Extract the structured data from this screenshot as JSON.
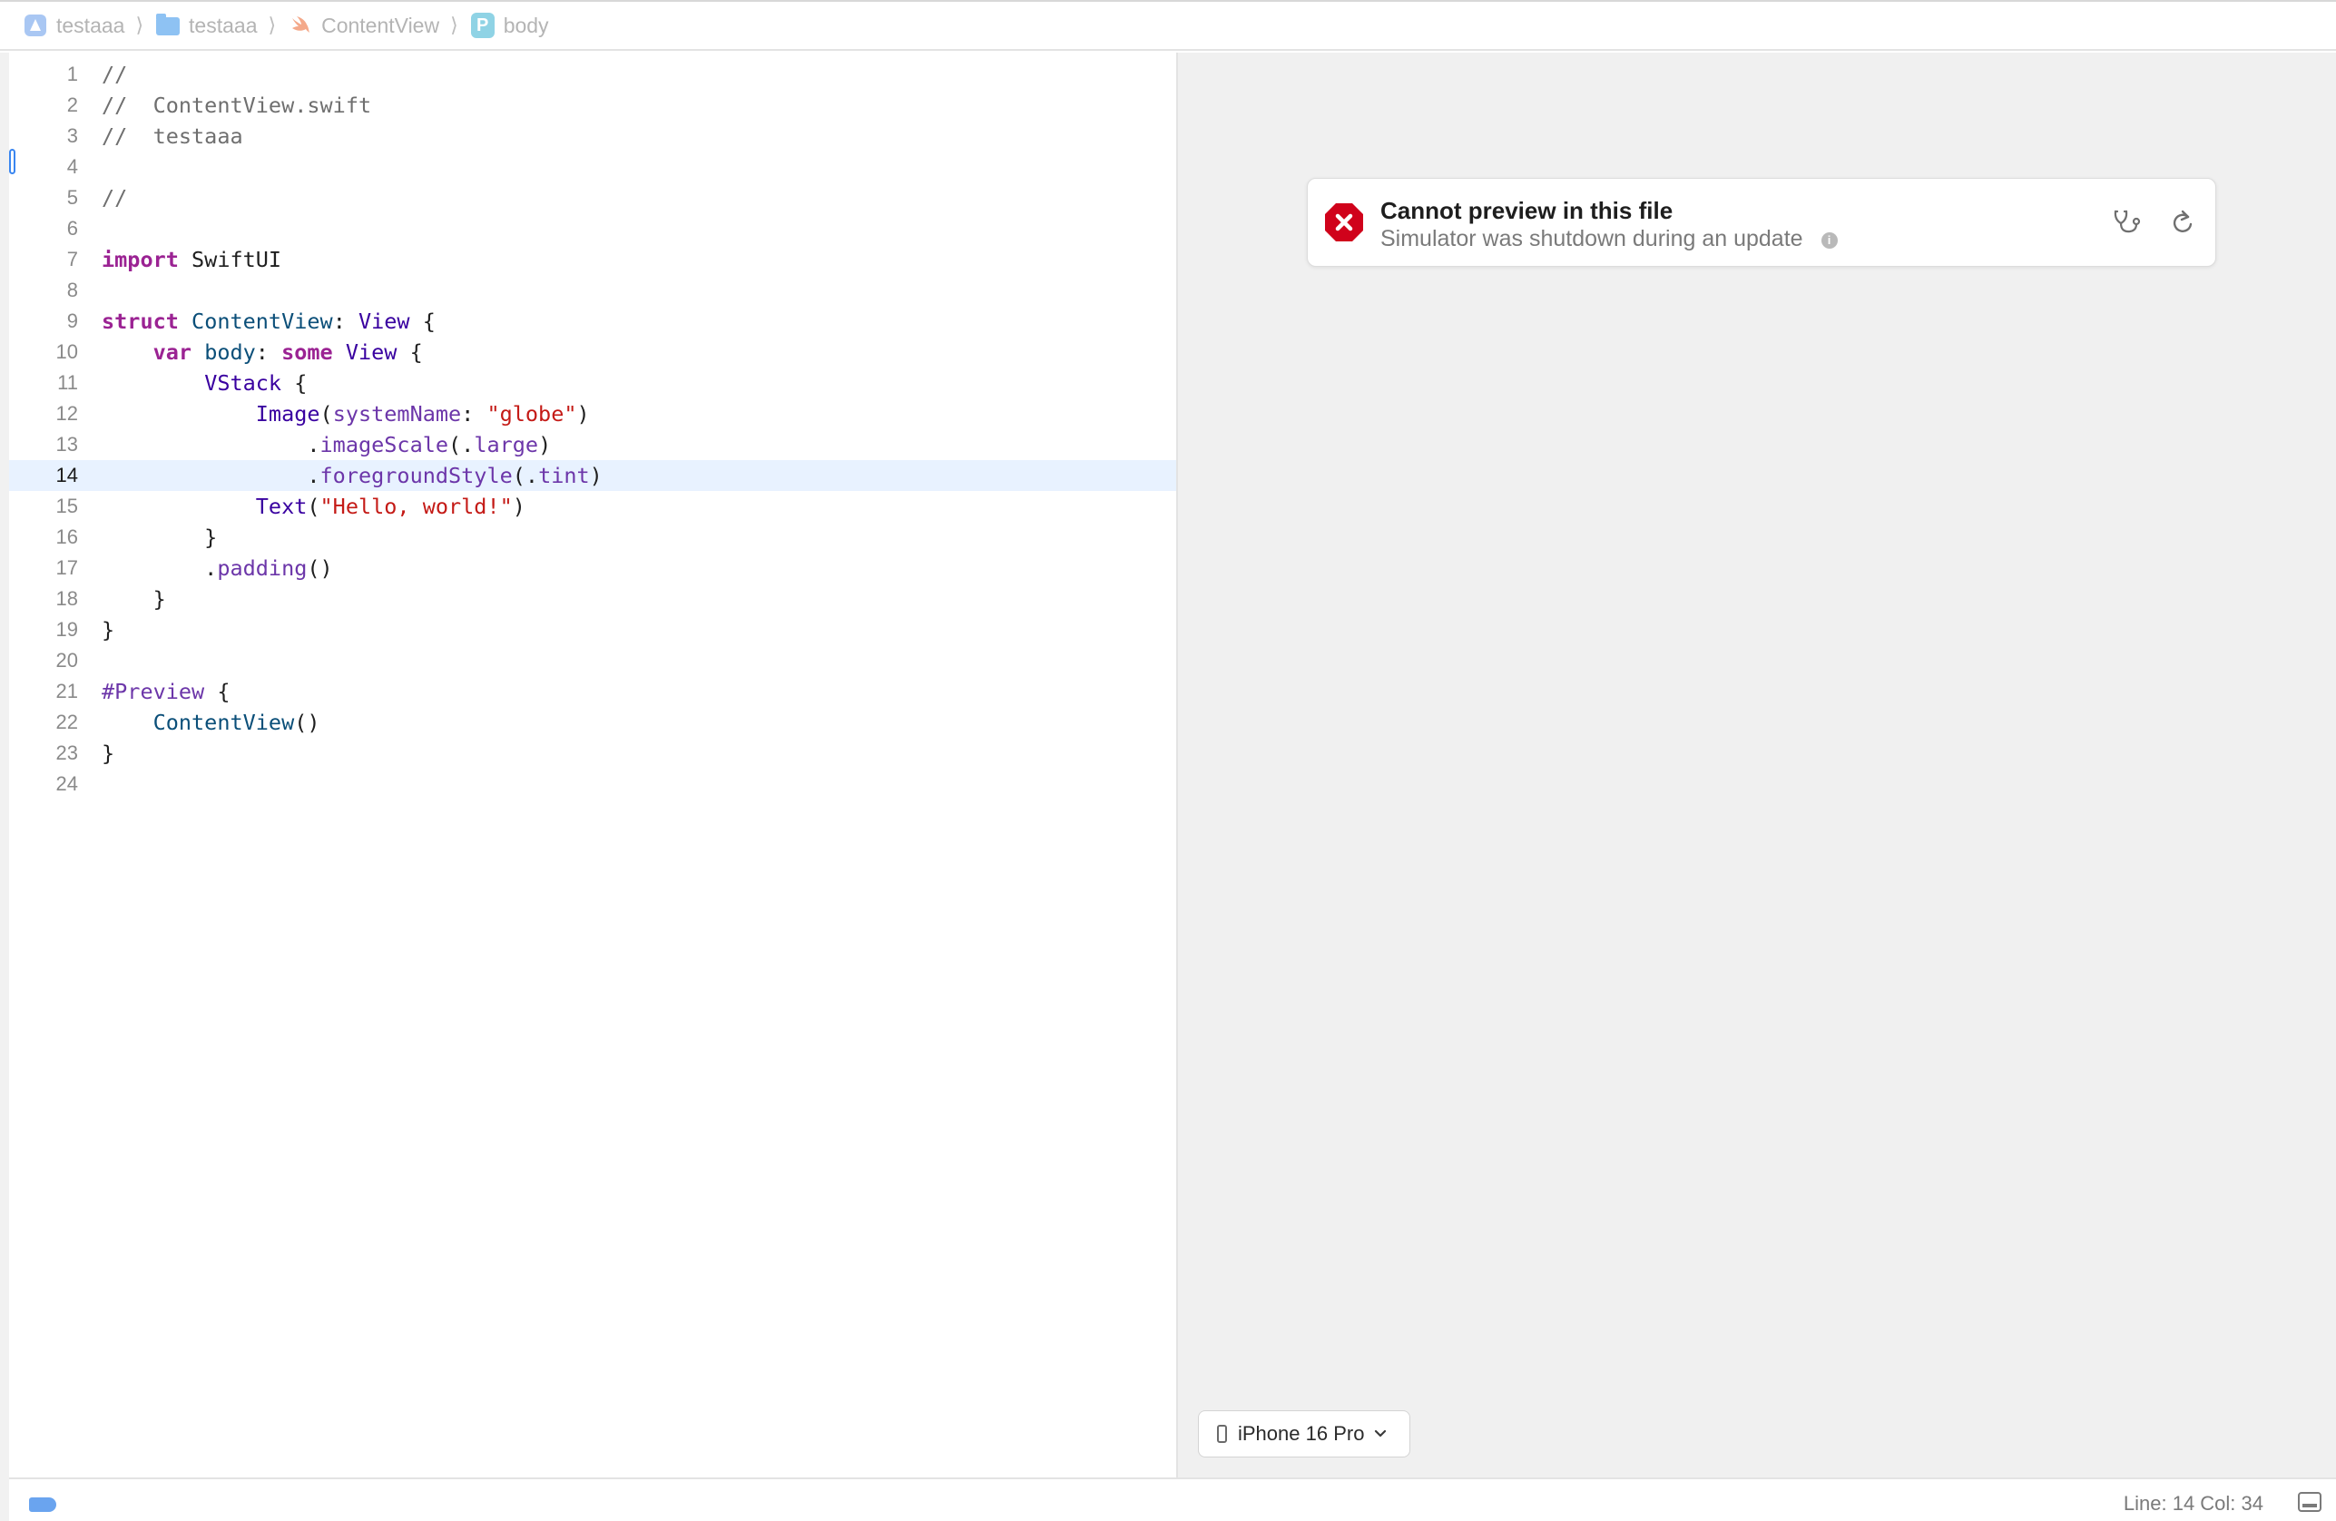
{
  "breadcrumb": {
    "items": [
      {
        "label": "testaaa",
        "icon": "app-project-icon"
      },
      {
        "label": "testaaa",
        "icon": "folder-icon"
      },
      {
        "label": "ContentView",
        "icon": "swift-file-icon"
      },
      {
        "label": "body",
        "icon": "property-icon",
        "badge": "P"
      }
    ]
  },
  "editor": {
    "current_line": 14,
    "lines": [
      {
        "n": "1",
        "tokens": [
          [
            "com",
            "//"
          ]
        ]
      },
      {
        "n": "2",
        "tokens": [
          [
            "com",
            "//  ContentView.swift"
          ]
        ]
      },
      {
        "n": "3",
        "tokens": [
          [
            "com",
            "//  testaaa"
          ]
        ]
      },
      {
        "n": "4",
        "tokens": []
      },
      {
        "n": "5",
        "tokens": [
          [
            "com",
            "//"
          ]
        ]
      },
      {
        "n": "6",
        "tokens": []
      },
      {
        "n": "7",
        "tokens": [
          [
            "kw",
            "import"
          ],
          [
            "plain",
            " SwiftUI"
          ]
        ]
      },
      {
        "n": "8",
        "tokens": []
      },
      {
        "n": "9",
        "tokens": [
          [
            "kw",
            "struct"
          ],
          [
            "plain",
            " "
          ],
          [
            "type",
            "ContentView"
          ],
          [
            "plain",
            ": "
          ],
          [
            "sys",
            "View"
          ],
          [
            "plain",
            " {"
          ]
        ]
      },
      {
        "n": "10",
        "tokens": [
          [
            "plain",
            "    "
          ],
          [
            "kw",
            "var"
          ],
          [
            "plain",
            " "
          ],
          [
            "type",
            "body"
          ],
          [
            "plain",
            ": "
          ],
          [
            "kw",
            "some"
          ],
          [
            "plain",
            " "
          ],
          [
            "sys",
            "View"
          ],
          [
            "plain",
            " {"
          ]
        ]
      },
      {
        "n": "11",
        "tokens": [
          [
            "plain",
            "        "
          ],
          [
            "sys",
            "VStack"
          ],
          [
            "plain",
            " {"
          ]
        ]
      },
      {
        "n": "12",
        "tokens": [
          [
            "plain",
            "            "
          ],
          [
            "sys",
            "Image"
          ],
          [
            "plain",
            "("
          ],
          [
            "prop",
            "systemName"
          ],
          [
            "plain",
            ": "
          ],
          [
            "str",
            "\"globe\""
          ],
          [
            "plain",
            ")"
          ]
        ]
      },
      {
        "n": "13",
        "tokens": [
          [
            "plain",
            "                ."
          ],
          [
            "prop",
            "imageScale"
          ],
          [
            "plain",
            "(."
          ],
          [
            "prop",
            "large"
          ],
          [
            "plain",
            ")"
          ]
        ]
      },
      {
        "n": "14",
        "tokens": [
          [
            "plain",
            "                ."
          ],
          [
            "prop",
            "foregroundStyle"
          ],
          [
            "plain",
            "(."
          ],
          [
            "prop",
            "tint"
          ],
          [
            "plain",
            ")"
          ]
        ]
      },
      {
        "n": "15",
        "tokens": [
          [
            "plain",
            "            "
          ],
          [
            "sys",
            "Text"
          ],
          [
            "plain",
            "("
          ],
          [
            "str",
            "\"Hello, world!\""
          ],
          [
            "plain",
            ")"
          ]
        ]
      },
      {
        "n": "16",
        "tokens": [
          [
            "plain",
            "        }"
          ]
        ]
      },
      {
        "n": "17",
        "tokens": [
          [
            "plain",
            "        ."
          ],
          [
            "prop",
            "padding"
          ],
          [
            "plain",
            "()"
          ]
        ]
      },
      {
        "n": "18",
        "tokens": [
          [
            "plain",
            "    }"
          ]
        ]
      },
      {
        "n": "19",
        "tokens": [
          [
            "plain",
            "}"
          ]
        ]
      },
      {
        "n": "20",
        "tokens": []
      },
      {
        "n": "21",
        "tokens": [
          [
            "prop",
            "#Preview"
          ],
          [
            "plain",
            " {"
          ]
        ]
      },
      {
        "n": "22",
        "tokens": [
          [
            "plain",
            "    "
          ],
          [
            "type",
            "ContentView"
          ],
          [
            "plain",
            "()"
          ]
        ]
      },
      {
        "n": "23",
        "tokens": [
          [
            "plain",
            "}"
          ]
        ]
      },
      {
        "n": "24",
        "tokens": []
      }
    ]
  },
  "preview": {
    "error_title": "Cannot preview in this file",
    "error_subtitle": "Simulator was shutdown during an update",
    "info_glyph": "i",
    "device_label": "iPhone 16 Pro"
  },
  "status": {
    "line_col": "Line: 14  Col: 34"
  },
  "colors": {
    "keyword": "#9b2393",
    "type": "#0b4f79",
    "system": "#3900a0",
    "property": "#6c36a9",
    "string": "#c41a16",
    "error": "#d0021b",
    "current_line": "#e8f2ff"
  }
}
